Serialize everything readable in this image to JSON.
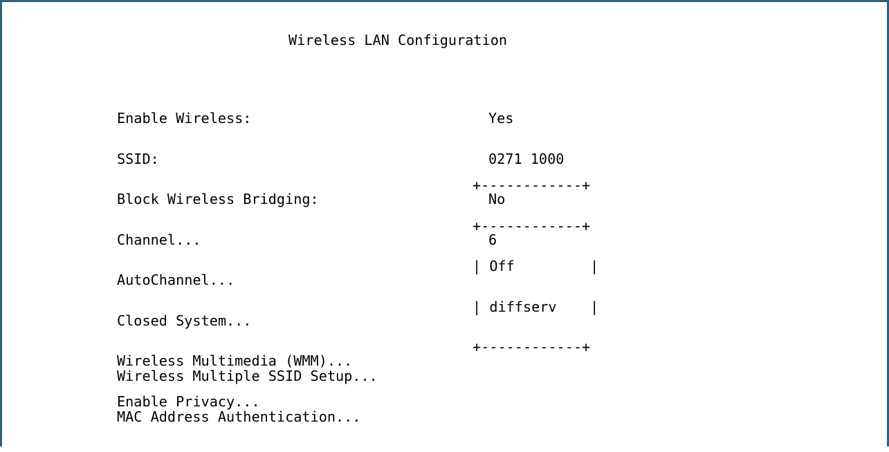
{
  "screen": {
    "title": "Wireless LAN Configuration"
  },
  "settings": [
    {
      "label": "Enable Wireless:",
      "value": "Yes"
    },
    {
      "label": "SSID:",
      "value": "0271 1000"
    },
    {
      "label": "Block Wireless Bridging:",
      "value": "No"
    },
    {
      "label": "Channel...",
      "value": "6"
    },
    {
      "label": "AutoChannel..."
    },
    {
      "label": "Closed System..."
    },
    {
      "label": "Wireless Multimedia (WMM)..."
    },
    {
      "label": "Enable Privacy..."
    }
  ],
  "popup": {
    "border_top": "+------------+",
    "border_separator": "+------------+",
    "border_bottom": "+------------+",
    "side": "|",
    "options": [
      "Off",
      "diffserv"
    ]
  },
  "links": [
    {
      "label": "Wireless Multiple SSID Setup..."
    },
    {
      "label": "MAC Address Authentication..."
    }
  ],
  "colors": {
    "frame": "#2f5f7e",
    "text": "#000000",
    "background": "#ffffff"
  }
}
